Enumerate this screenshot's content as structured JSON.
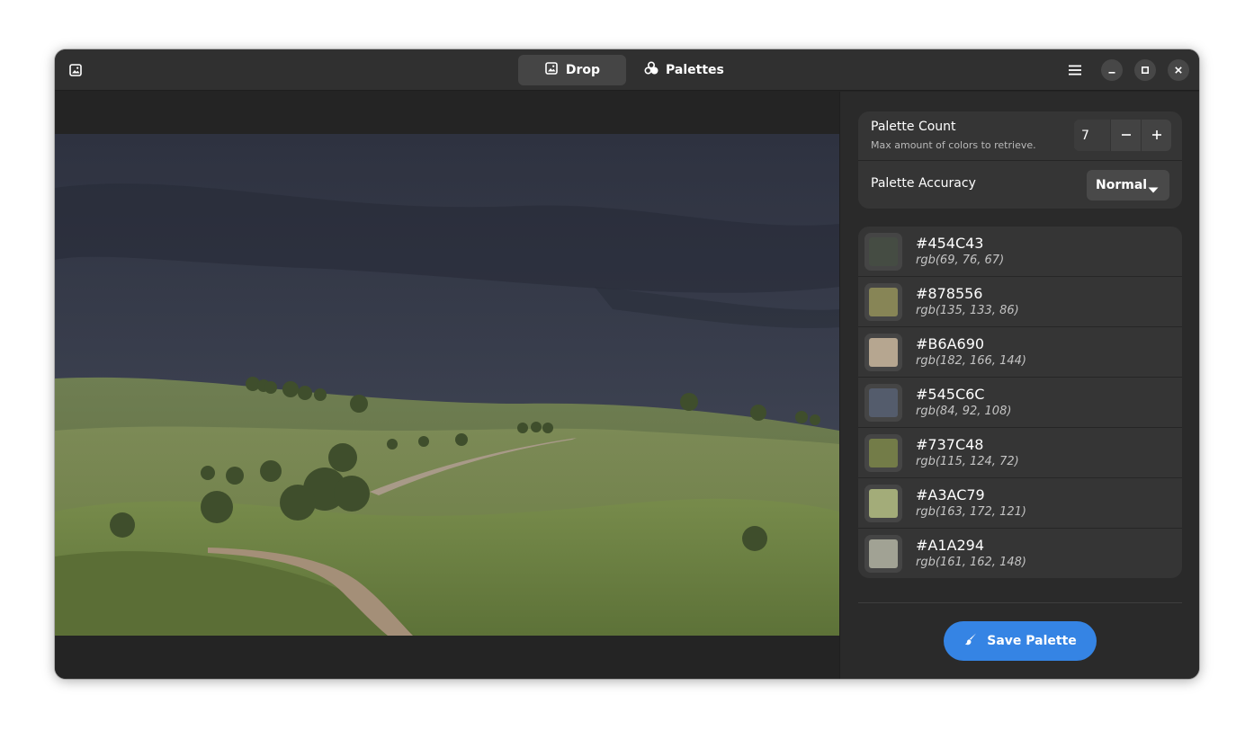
{
  "header": {
    "tabs": [
      {
        "label": "Drop",
        "icon": "image-icon",
        "active": true
      },
      {
        "label": "Palettes",
        "icon": "palette-icon",
        "active": false
      }
    ]
  },
  "settings": {
    "palette_count": {
      "title": "Palette Count",
      "subtitle": "Max amount of colors to retrieve.",
      "value": "7"
    },
    "palette_accuracy": {
      "title": "Palette Accuracy",
      "value": "Normal"
    }
  },
  "palette": [
    {
      "hex": "#454C43",
      "rgb": "rgb(69, 76, 67)"
    },
    {
      "hex": "#878556",
      "rgb": "rgb(135, 133, 86)"
    },
    {
      "hex": "#B6A690",
      "rgb": "rgb(182, 166, 144)"
    },
    {
      "hex": "#545C6C",
      "rgb": "rgb(84, 92, 108)"
    },
    {
      "hex": "#737C48",
      "rgb": "rgb(115, 124, 72)"
    },
    {
      "hex": "#A3AC79",
      "rgb": "rgb(163, 172, 121)"
    },
    {
      "hex": "#A1A294",
      "rgb": "rgb(161, 162, 148)"
    }
  ],
  "save_button": {
    "label": "Save Palette"
  },
  "colors": {
    "accent": "#3584e4",
    "window_bg": "#242424",
    "headerbar": "#303030",
    "card": "#353535"
  }
}
